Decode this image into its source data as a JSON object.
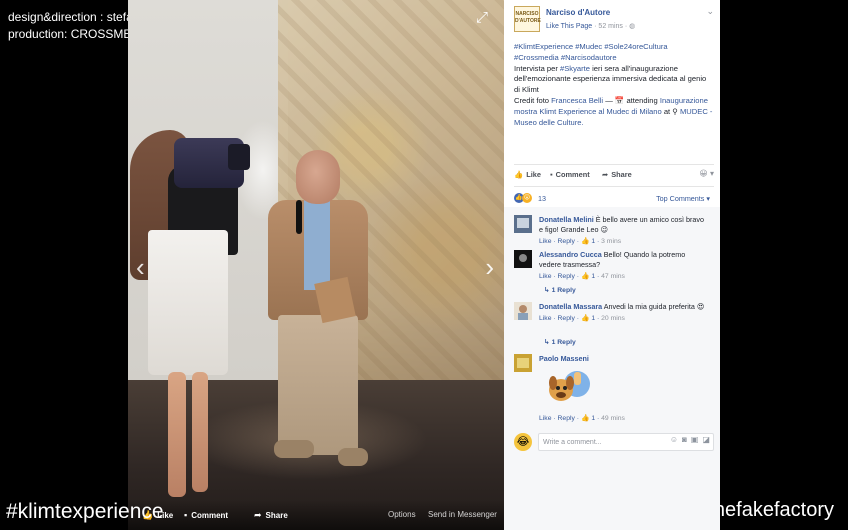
{
  "overlay": {
    "credit_line1": "design&direction : stefano fake / THEFAKEFACTORY",
    "credit_line2": "production: CROSSMEDIA GROUP FLORENCE, ITALY",
    "hashtag": "#klimtexperience",
    "handle": "@thefakefactory"
  },
  "photo": {
    "expand_icon": "expand-icon",
    "prev_arrow": "‹",
    "next_arrow": "›",
    "bar": {
      "like": "Like",
      "comment": "Comment",
      "share": "Share",
      "options": "Options",
      "send": "Send in Messenger"
    }
  },
  "post": {
    "page_logo_text": "NARCISO D'AUTORE",
    "page_name": "Narciso d'Autore",
    "like_page": "Like This Page",
    "time": "52 mins",
    "text_tags1": "#KlimtExperience #Mudec #Sole24oreCultura",
    "text_tags2": "#Crossmedia #Narcisodautore",
    "text_body1": "Intervista per ",
    "text_skyarte": "#Skyarte",
    "text_body2": " ieri sera all'inaugurazione dell'emozionante esperienza immersiva dedicata al genio di Klimt",
    "credit_prefix": "Credit foto ",
    "credit_name": "Francesca Belli",
    "credit_attending": " — 📅 attending",
    "event_link": "Inaugurazione mostra Klimt Experience al Mudec di Milano",
    "at_text": " at ",
    "place_link": "MUDEC - Museo delle Culture."
  },
  "actions": {
    "like": "Like",
    "comment": "Comment",
    "share": "Share"
  },
  "reactions": {
    "count": "13",
    "top_comments": "Top Comments ▾"
  },
  "comments": [
    {
      "author": "Donatella Melini",
      "text": " È bello avere un amico così bravo e figo! Grande Leo 😉",
      "like": "Like",
      "reply": "Reply",
      "likes": "1",
      "time": "3 mins"
    },
    {
      "author": "Alessandro Cucca",
      "text": " Bello! Quando la potremo vedere trasmessa?",
      "like": "Like",
      "reply": "Reply",
      "likes": "1",
      "time": "47 mins",
      "replies": "1 Reply"
    },
    {
      "author": "Donatella Massara",
      "text": " Anvedi la mia guida preferita 😍",
      "like": "Like",
      "reply": "Reply",
      "likes": "1",
      "time": "20 mins",
      "replies": "1 Reply"
    },
    {
      "author": "Paolo Masseni",
      "text": "",
      "like": "Like",
      "reply": "Reply",
      "likes": "1",
      "time": "49 mins"
    }
  ],
  "write_comment": {
    "placeholder": "Write a comment..."
  },
  "colors": {
    "fb_link": "#365899",
    "fb_text": "#1d2129",
    "fb_meta": "#90949c"
  }
}
